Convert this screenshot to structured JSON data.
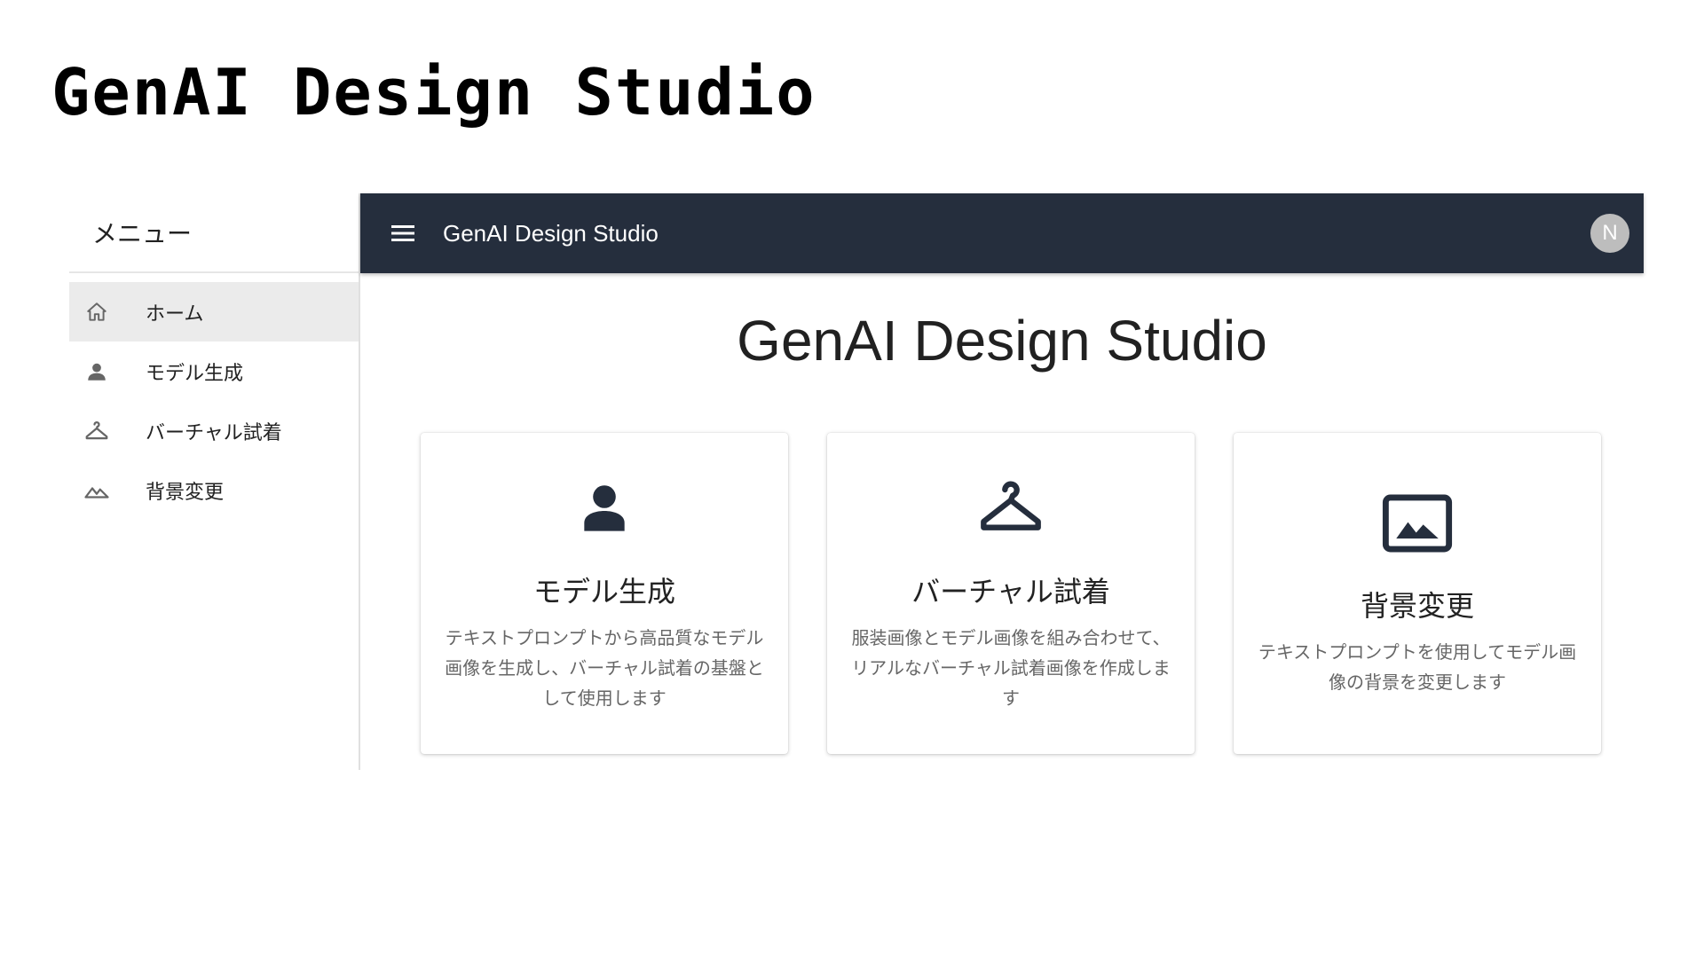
{
  "slide": {
    "title": "GenAI Design Studio"
  },
  "sidebar": {
    "header": "メニュー",
    "items": [
      {
        "label": "ホーム",
        "icon": "home-icon",
        "active": true
      },
      {
        "label": "モデル生成",
        "icon": "person-icon",
        "active": false
      },
      {
        "label": "バーチャル試着",
        "icon": "hanger-icon",
        "active": false
      },
      {
        "label": "背景変更",
        "icon": "landscape-icon",
        "active": false
      }
    ]
  },
  "appbar": {
    "title": "GenAI Design Studio",
    "avatar_initial": "N",
    "background": "#252e3d"
  },
  "main": {
    "heading": "GenAI Design Studio",
    "cards": [
      {
        "icon": "person-icon",
        "title": "モデル生成",
        "description": "テキストプロンプトから高品質なモデル画像を生成し、バーチャル試着の基盤として使用します"
      },
      {
        "icon": "hanger-icon",
        "title": "バーチャル試着",
        "description": "服装画像とモデル画像を組み合わせて、リアルなバーチャル試着画像を作成します"
      },
      {
        "icon": "image-icon",
        "title": "背景変更",
        "description": "テキストプロンプトを使用してモデル画像の背景を変更します"
      }
    ]
  }
}
